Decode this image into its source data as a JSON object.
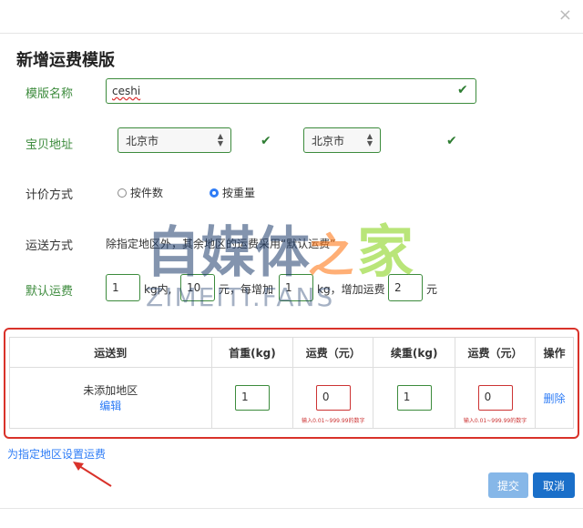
{
  "dialog": {
    "title": "新增运费模版",
    "close_glyph": "×"
  },
  "form": {
    "template_name": {
      "label": "模版名称",
      "value": "ceshi"
    },
    "location": {
      "label": "宝贝地址",
      "province": "北京市",
      "city": "北京市"
    },
    "pricing": {
      "label": "计价方式",
      "options": [
        "按件数",
        "按重量"
      ],
      "selected": "按重量"
    },
    "shipping": {
      "label": "运送方式",
      "note": "除指定地区外，其余地区的运费采用“默认运费”"
    },
    "default_fee": {
      "label": "默认运费",
      "first_weight": "1",
      "unit_kg_in": "kg内,",
      "first_fee": "10",
      "text_yuan_each": "元，每增加",
      "extra_weight": "1",
      "text_kg_add": "kg，增加运费",
      "extra_fee": "2",
      "text_yuan": "元"
    }
  },
  "watermark": {
    "main": "自媒体之家",
    "sub": "ZIMEITI.FANS"
  },
  "table": {
    "headers": [
      "运送到",
      "首重(kg)",
      "运费（元）",
      "续重(kg)",
      "运费（元）",
      "操作"
    ],
    "row": {
      "area": "未添加地区",
      "edit": "编辑",
      "first_weight": "1",
      "first_fee": "0",
      "extra_weight": "1",
      "extra_fee": "0",
      "hint": "输入0.01~999.99的数字",
      "delete": "删除"
    }
  },
  "link_set_region": "为指定地区设置运费",
  "buttons": {
    "submit": "提交",
    "cancel": "取消"
  },
  "colors": {
    "accent": "#1a6fc9",
    "valid_green": "#3c8b3c",
    "error_red": "#d9322a"
  }
}
